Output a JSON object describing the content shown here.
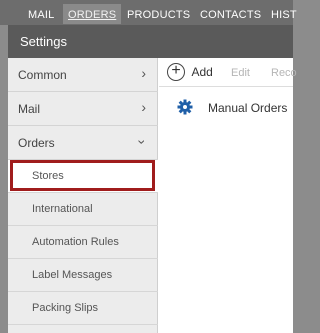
{
  "topnav": {
    "items": [
      "MAIL",
      "ORDERS",
      "PRODUCTS",
      "CONTACTS",
      "HIST"
    ],
    "active_index": 1
  },
  "dialog": {
    "title": "Settings"
  },
  "sidebar": {
    "groups": [
      {
        "label": "Common",
        "icon": "chevron-right-icon"
      },
      {
        "label": "Mail",
        "icon": "chevron-right-icon"
      },
      {
        "label": "Orders",
        "icon": "chevron-down-icon"
      }
    ],
    "subitems": [
      "Stores",
      "International",
      "Automation Rules",
      "Label Messages",
      "Packing Slips"
    ],
    "selected": "Stores"
  },
  "toolbar": {
    "add_label": "Add",
    "edit_label": "Edit",
    "reco_label": "Reco"
  },
  "list": {
    "rows": [
      {
        "label": "Manual Orders",
        "icon": "gear-icon"
      }
    ]
  },
  "colors": {
    "selection_border": "#a01c1c",
    "gear": "#1f5fa8",
    "titlebar": "#5a5a5a"
  }
}
